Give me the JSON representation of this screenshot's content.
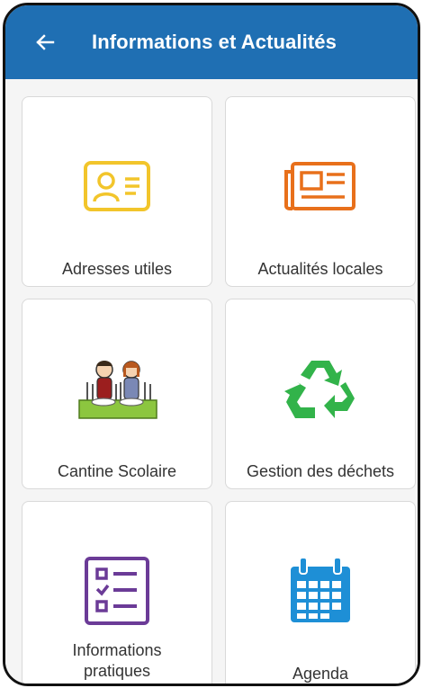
{
  "header": {
    "title": "Informations et Actualités",
    "color": "#1f6fb3"
  },
  "tiles": [
    {
      "label": "Adresses utiles",
      "icon": "contact-card-icon",
      "icon_color": "#f2c52b"
    },
    {
      "label": "Actualités locales",
      "icon": "newspaper-icon",
      "icon_color": "#e8701b"
    },
    {
      "label": "Cantine Scolaire",
      "icon": "school-canteen-icon"
    },
    {
      "label": "Gestion des déchets",
      "icon": "recycle-icon",
      "icon_color": "#32b34a"
    },
    {
      "label_line1": "Informations",
      "label_line2": "pratiques",
      "icon": "checklist-icon",
      "icon_color": "#6b3b97"
    },
    {
      "label": "Agenda",
      "icon": "calendar-icon",
      "icon_color": "#1e8fd6"
    }
  ]
}
